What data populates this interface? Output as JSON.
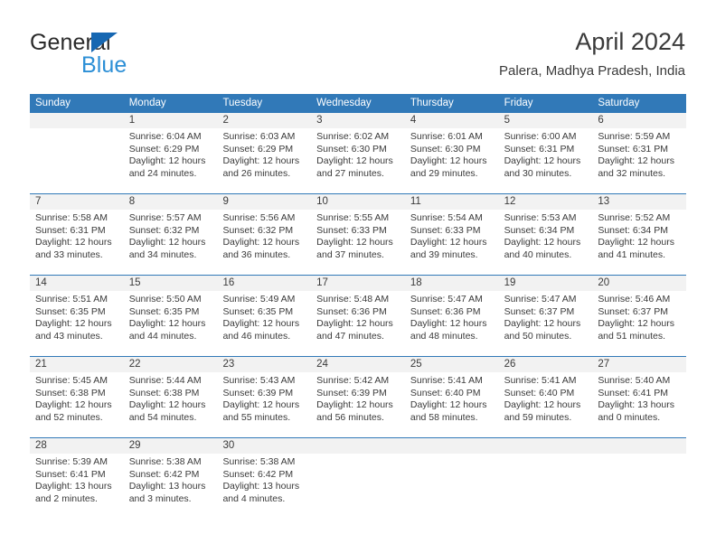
{
  "brand": {
    "name_part1": "General",
    "name_part2": "Blue",
    "colors": {
      "triangle": "#1667b2",
      "blue_text": "#2c8fd6",
      "dark_text": "#2a2a2a"
    }
  },
  "header": {
    "title": "April 2024",
    "subtitle": "Palera, Madhya Pradesh, India"
  },
  "theme": {
    "header_blue": "#3179b8",
    "daynum_band": "#f2f2f2",
    "body_white": "#ffffff",
    "text": "#3a3a3a"
  },
  "calendar": {
    "weekdays": [
      "Sunday",
      "Monday",
      "Tuesday",
      "Wednesday",
      "Thursday",
      "Friday",
      "Saturday"
    ],
    "weeks": [
      {
        "days": [
          {
            "num": "",
            "lines": [
              "",
              "",
              "",
              ""
            ]
          },
          {
            "num": "1",
            "lines": [
              "Sunrise: 6:04 AM",
              "Sunset: 6:29 PM",
              "Daylight: 12 hours",
              "and 24 minutes."
            ]
          },
          {
            "num": "2",
            "lines": [
              "Sunrise: 6:03 AM",
              "Sunset: 6:29 PM",
              "Daylight: 12 hours",
              "and 26 minutes."
            ]
          },
          {
            "num": "3",
            "lines": [
              "Sunrise: 6:02 AM",
              "Sunset: 6:30 PM",
              "Daylight: 12 hours",
              "and 27 minutes."
            ]
          },
          {
            "num": "4",
            "lines": [
              "Sunrise: 6:01 AM",
              "Sunset: 6:30 PM",
              "Daylight: 12 hours",
              "and 29 minutes."
            ]
          },
          {
            "num": "5",
            "lines": [
              "Sunrise: 6:00 AM",
              "Sunset: 6:31 PM",
              "Daylight: 12 hours",
              "and 30 minutes."
            ]
          },
          {
            "num": "6",
            "lines": [
              "Sunrise: 5:59 AM",
              "Sunset: 6:31 PM",
              "Daylight: 12 hours",
              "and 32 minutes."
            ]
          }
        ]
      },
      {
        "days": [
          {
            "num": "7",
            "lines": [
              "Sunrise: 5:58 AM",
              "Sunset: 6:31 PM",
              "Daylight: 12 hours",
              "and 33 minutes."
            ]
          },
          {
            "num": "8",
            "lines": [
              "Sunrise: 5:57 AM",
              "Sunset: 6:32 PM",
              "Daylight: 12 hours",
              "and 34 minutes."
            ]
          },
          {
            "num": "9",
            "lines": [
              "Sunrise: 5:56 AM",
              "Sunset: 6:32 PM",
              "Daylight: 12 hours",
              "and 36 minutes."
            ]
          },
          {
            "num": "10",
            "lines": [
              "Sunrise: 5:55 AM",
              "Sunset: 6:33 PM",
              "Daylight: 12 hours",
              "and 37 minutes."
            ]
          },
          {
            "num": "11",
            "lines": [
              "Sunrise: 5:54 AM",
              "Sunset: 6:33 PM",
              "Daylight: 12 hours",
              "and 39 minutes."
            ]
          },
          {
            "num": "12",
            "lines": [
              "Sunrise: 5:53 AM",
              "Sunset: 6:34 PM",
              "Daylight: 12 hours",
              "and 40 minutes."
            ]
          },
          {
            "num": "13",
            "lines": [
              "Sunrise: 5:52 AM",
              "Sunset: 6:34 PM",
              "Daylight: 12 hours",
              "and 41 minutes."
            ]
          }
        ]
      },
      {
        "days": [
          {
            "num": "14",
            "lines": [
              "Sunrise: 5:51 AM",
              "Sunset: 6:35 PM",
              "Daylight: 12 hours",
              "and 43 minutes."
            ]
          },
          {
            "num": "15",
            "lines": [
              "Sunrise: 5:50 AM",
              "Sunset: 6:35 PM",
              "Daylight: 12 hours",
              "and 44 minutes."
            ]
          },
          {
            "num": "16",
            "lines": [
              "Sunrise: 5:49 AM",
              "Sunset: 6:35 PM",
              "Daylight: 12 hours",
              "and 46 minutes."
            ]
          },
          {
            "num": "17",
            "lines": [
              "Sunrise: 5:48 AM",
              "Sunset: 6:36 PM",
              "Daylight: 12 hours",
              "and 47 minutes."
            ]
          },
          {
            "num": "18",
            "lines": [
              "Sunrise: 5:47 AM",
              "Sunset: 6:36 PM",
              "Daylight: 12 hours",
              "and 48 minutes."
            ]
          },
          {
            "num": "19",
            "lines": [
              "Sunrise: 5:47 AM",
              "Sunset: 6:37 PM",
              "Daylight: 12 hours",
              "and 50 minutes."
            ]
          },
          {
            "num": "20",
            "lines": [
              "Sunrise: 5:46 AM",
              "Sunset: 6:37 PM",
              "Daylight: 12 hours",
              "and 51 minutes."
            ]
          }
        ]
      },
      {
        "days": [
          {
            "num": "21",
            "lines": [
              "Sunrise: 5:45 AM",
              "Sunset: 6:38 PM",
              "Daylight: 12 hours",
              "and 52 minutes."
            ]
          },
          {
            "num": "22",
            "lines": [
              "Sunrise: 5:44 AM",
              "Sunset: 6:38 PM",
              "Daylight: 12 hours",
              "and 54 minutes."
            ]
          },
          {
            "num": "23",
            "lines": [
              "Sunrise: 5:43 AM",
              "Sunset: 6:39 PM",
              "Daylight: 12 hours",
              "and 55 minutes."
            ]
          },
          {
            "num": "24",
            "lines": [
              "Sunrise: 5:42 AM",
              "Sunset: 6:39 PM",
              "Daylight: 12 hours",
              "and 56 minutes."
            ]
          },
          {
            "num": "25",
            "lines": [
              "Sunrise: 5:41 AM",
              "Sunset: 6:40 PM",
              "Daylight: 12 hours",
              "and 58 minutes."
            ]
          },
          {
            "num": "26",
            "lines": [
              "Sunrise: 5:41 AM",
              "Sunset: 6:40 PM",
              "Daylight: 12 hours",
              "and 59 minutes."
            ]
          },
          {
            "num": "27",
            "lines": [
              "Sunrise: 5:40 AM",
              "Sunset: 6:41 PM",
              "Daylight: 13 hours",
              "and 0 minutes."
            ]
          }
        ]
      },
      {
        "days": [
          {
            "num": "28",
            "lines": [
              "Sunrise: 5:39 AM",
              "Sunset: 6:41 PM",
              "Daylight: 13 hours",
              "and 2 minutes."
            ]
          },
          {
            "num": "29",
            "lines": [
              "Sunrise: 5:38 AM",
              "Sunset: 6:42 PM",
              "Daylight: 13 hours",
              "and 3 minutes."
            ]
          },
          {
            "num": "30",
            "lines": [
              "Sunrise: 5:38 AM",
              "Sunset: 6:42 PM",
              "Daylight: 13 hours",
              "and 4 minutes."
            ]
          },
          {
            "num": "",
            "lines": [
              "",
              "",
              "",
              ""
            ]
          },
          {
            "num": "",
            "lines": [
              "",
              "",
              "",
              ""
            ]
          },
          {
            "num": "",
            "lines": [
              "",
              "",
              "",
              ""
            ]
          },
          {
            "num": "",
            "lines": [
              "",
              "",
              "",
              ""
            ]
          }
        ]
      }
    ]
  }
}
